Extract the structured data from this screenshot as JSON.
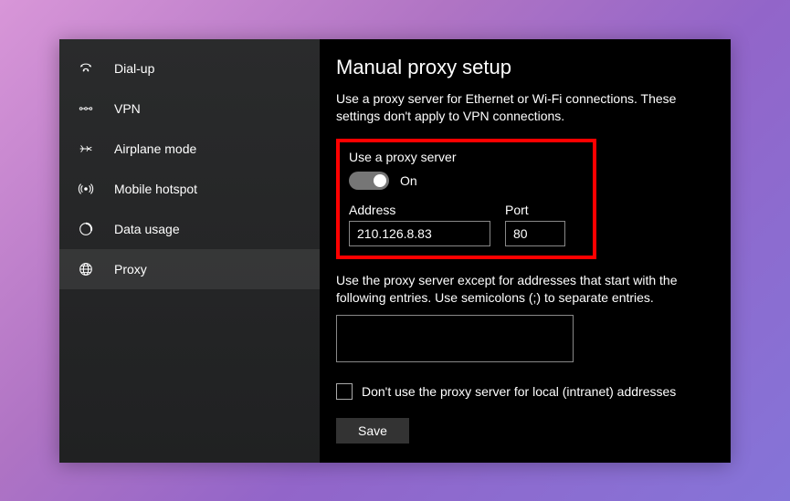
{
  "sidebar": {
    "items": [
      {
        "label": "Dial-up",
        "icon": "dialup"
      },
      {
        "label": "VPN",
        "icon": "vpn"
      },
      {
        "label": "Airplane mode",
        "icon": "airplane"
      },
      {
        "label": "Mobile hotspot",
        "icon": "hotspot"
      },
      {
        "label": "Data usage",
        "icon": "datausage"
      },
      {
        "label": "Proxy",
        "icon": "proxy"
      }
    ],
    "selected_index": 5
  },
  "content": {
    "title": "Manual proxy setup",
    "description": "Use a proxy server for Ethernet or Wi-Fi connections. These settings don't apply to VPN connections.",
    "proxy": {
      "toggle_header": "Use a proxy server",
      "toggle_state": "On",
      "address_label": "Address",
      "address_value": "210.126.8.83",
      "port_label": "Port",
      "port_value": "80"
    },
    "exceptions": {
      "description": "Use the proxy server except for addresses that start with the following entries. Use semicolons (;) to separate entries.",
      "value": ""
    },
    "local_bypass": {
      "label": "Don't use the proxy server for local (intranet) addresses",
      "checked": false
    },
    "save_button": "Save"
  }
}
